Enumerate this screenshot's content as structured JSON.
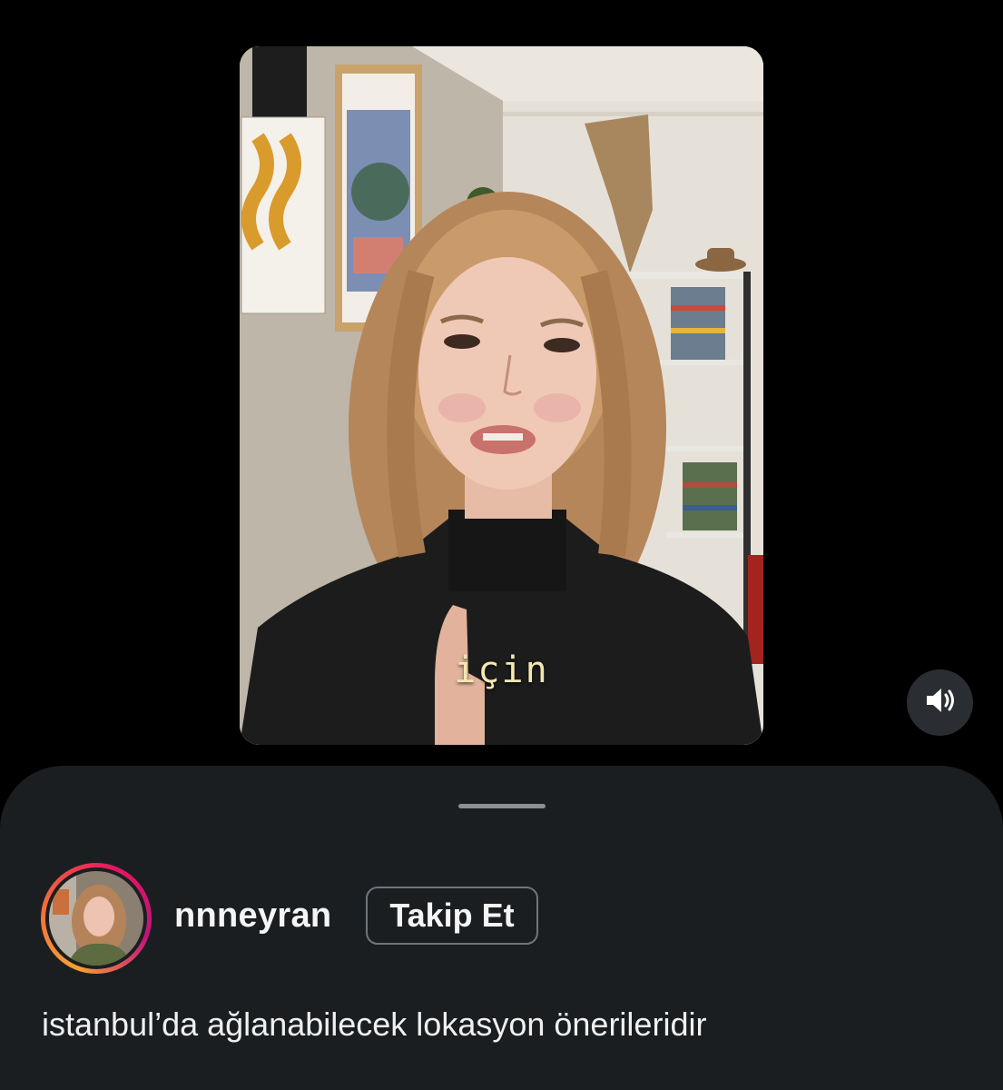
{
  "video": {
    "caption_text": "için",
    "sound_icon": "speaker-wave-icon"
  },
  "post": {
    "username": "nnneyran",
    "follow_label": "Takip Et",
    "description": "istanbul’da ağlanabilecek lokasyon önerileridir",
    "avatar_icon": "profile-photo"
  },
  "colors": {
    "background": "#000000",
    "sheet": "#1b1e21",
    "text": "#f5f5f5",
    "story_ring": [
      "#f9a134",
      "#e6165e",
      "#c1137d"
    ]
  }
}
